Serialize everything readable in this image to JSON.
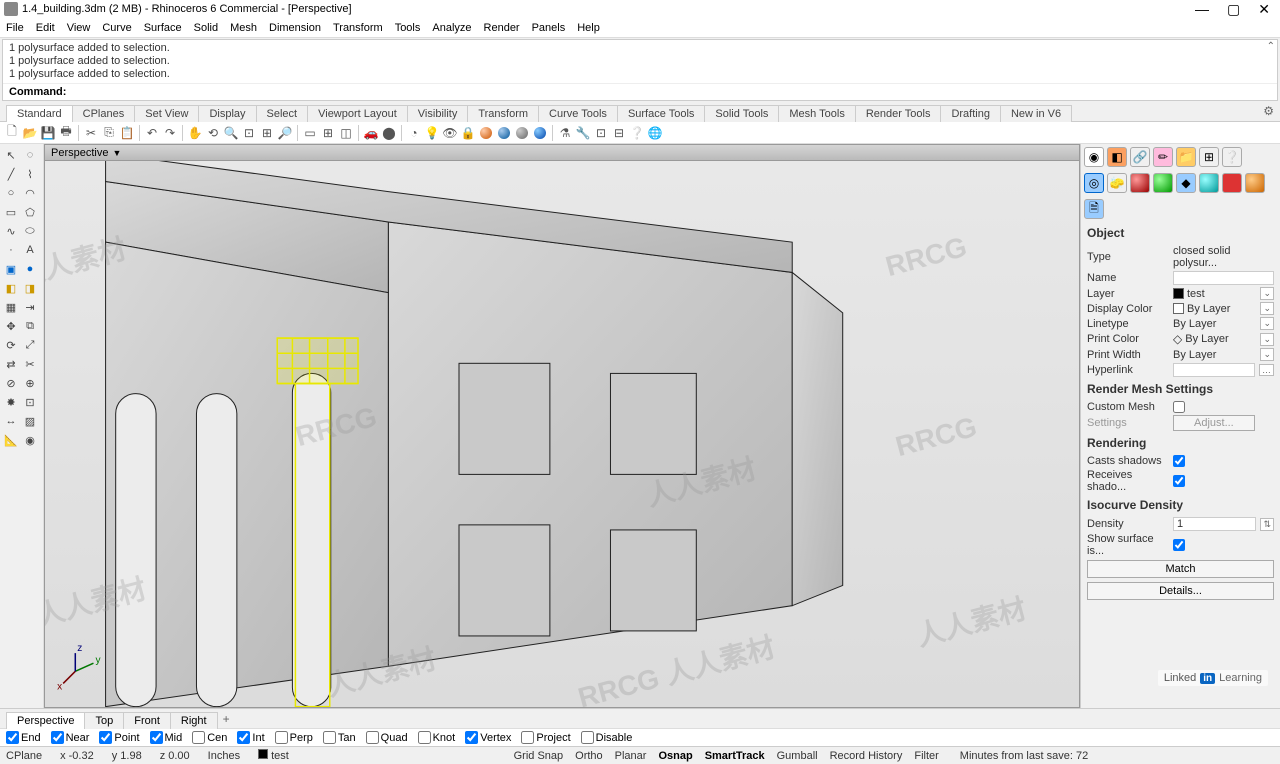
{
  "title": "1.4_building.3dm (2 MB) - Rhinoceros 6 Commercial - [Perspective]",
  "menu": [
    "File",
    "Edit",
    "View",
    "Curve",
    "Surface",
    "Solid",
    "Mesh",
    "Dimension",
    "Transform",
    "Tools",
    "Analyze",
    "Render",
    "Panels",
    "Help"
  ],
  "cmd_history": [
    "1 polysurface added to selection.",
    "1 polysurface added to selection.",
    "1 polysurface added to selection."
  ],
  "cmd_label": "Command:",
  "tabs": [
    "Standard",
    "CPlanes",
    "Set View",
    "Display",
    "Select",
    "Viewport Layout",
    "Visibility",
    "Transform",
    "Curve Tools",
    "Surface Tools",
    "Solid Tools",
    "Mesh Tools",
    "Render Tools",
    "Drafting",
    "New in V6"
  ],
  "viewport_title": "Perspective",
  "right": {
    "obj_header": "Object",
    "type_lbl": "Type",
    "type_val": "closed solid polysur...",
    "name_lbl": "Name",
    "name_val": "",
    "layer_lbl": "Layer",
    "layer_val": "test",
    "dispc_lbl": "Display Color",
    "dispc_val": "By Layer",
    "linet_lbl": "Linetype",
    "linet_val": "By Layer",
    "printc_lbl": "Print Color",
    "printc_val": "By Layer",
    "printw_lbl": "Print Width",
    "printw_val": "By Layer",
    "hyper_lbl": "Hyperlink",
    "rms_header": "Render Mesh Settings",
    "custommesh_lbl": "Custom Mesh",
    "settings_lbl": "Settings",
    "adjust_btn": "Adjust...",
    "rend_header": "Rendering",
    "casts_lbl": "Casts shadows",
    "recv_lbl": "Receives shado...",
    "iso_header": "Isocurve Density",
    "density_lbl": "Density",
    "density_val": "1",
    "showsurf_lbl": "Show surface is...",
    "match_btn": "Match",
    "details_btn": "Details..."
  },
  "viewtabs": [
    "Perspective",
    "Top",
    "Front",
    "Right"
  ],
  "osnap": [
    {
      "label": "End",
      "checked": true
    },
    {
      "label": "Near",
      "checked": true
    },
    {
      "label": "Point",
      "checked": true
    },
    {
      "label": "Mid",
      "checked": true
    },
    {
      "label": "Cen",
      "checked": false
    },
    {
      "label": "Int",
      "checked": true
    },
    {
      "label": "Perp",
      "checked": false
    },
    {
      "label": "Tan",
      "checked": false
    },
    {
      "label": "Quad",
      "checked": false
    },
    {
      "label": "Knot",
      "checked": false
    },
    {
      "label": "Vertex",
      "checked": true
    },
    {
      "label": "Project",
      "checked": false
    },
    {
      "label": "Disable",
      "checked": false
    }
  ],
  "status": {
    "cplane": "CPlane",
    "x": "x -0.32",
    "y": "y 1.98",
    "z": "z 0.00",
    "units": "Inches",
    "layer": "test",
    "bar": [
      "Grid Snap",
      "Ortho",
      "Planar",
      "Osnap",
      "SmartTrack",
      "Gumball",
      "Record History",
      "Filter"
    ],
    "bold_idx": [
      3,
      4
    ],
    "time": "Minutes from last save: 72"
  },
  "linkedin": "Learning"
}
